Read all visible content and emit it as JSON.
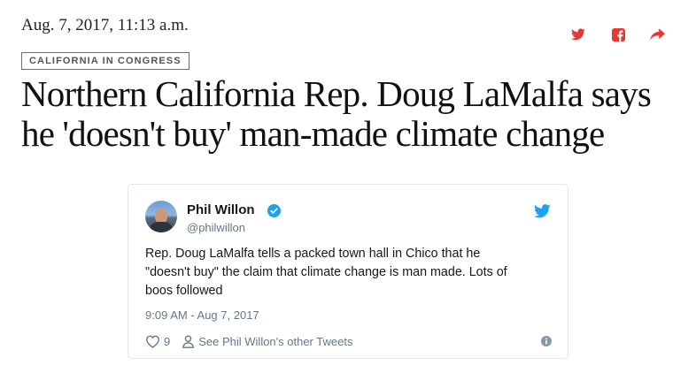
{
  "article": {
    "dateline": "Aug. 7, 2017, 11:13 a.m.",
    "tag": "CALIFORNIA IN CONGRESS",
    "headline_line1": "Northern California Rep. Doug LaMalfa says",
    "headline_line2": "he 'doesn't buy' man-made climate change"
  },
  "share": {
    "twitter_icon": "twitter-icon",
    "facebook_icon": "facebook-icon",
    "share_icon": "share-arrow-icon",
    "color": "#e53935"
  },
  "tweet": {
    "author_name": "Phil Willon",
    "handle": "@philwillon",
    "text_line1": "Rep. Doug LaMalfa tells a packed town hall in Chico that he",
    "text_line2": "\"doesn't buy\" the claim that climate change is man made. Lots of",
    "text_line3": "boos followed",
    "timestamp": "9:09 AM - Aug 7, 2017",
    "like_count": "9",
    "other_tweets_link": "See Phil Willon's other Tweets",
    "accent_color": "#1da1f2"
  }
}
